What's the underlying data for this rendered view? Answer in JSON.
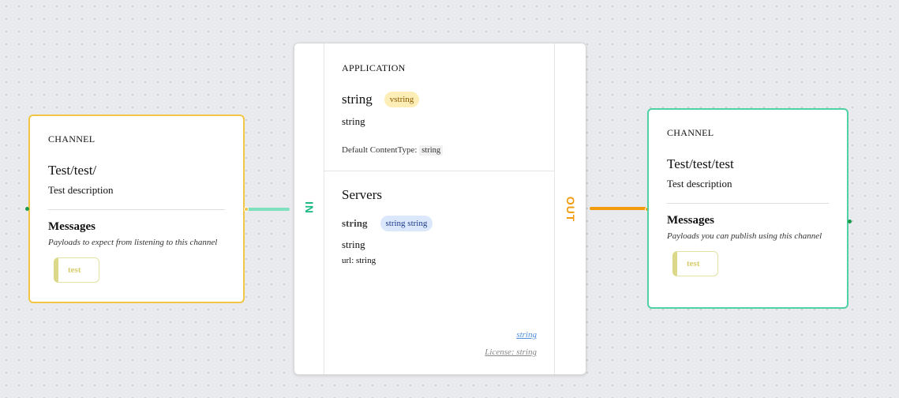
{
  "left_channel": {
    "type_label": "CHANNEL",
    "name": "Test/test/",
    "description": "Test description",
    "messages_title": "Messages",
    "messages_subtitle": "Payloads to expect from listening to this channel",
    "message_pill": "test"
  },
  "application": {
    "type_label": "APPLICATION",
    "title": "string",
    "version_badge": "vstring",
    "description": "string",
    "content_type_label": "Default ContentType:",
    "content_type_value": "string",
    "in_label": "IN",
    "out_label": "OUT",
    "servers": {
      "title": "Servers",
      "server_name": "string",
      "protocol_badge": "string string",
      "server_description": "string",
      "url_label": "url: string"
    },
    "terms_link": "string",
    "license_link": "License: string"
  },
  "right_channel": {
    "type_label": "CHANNEL",
    "name": "Test/test/test",
    "description": "Test description",
    "messages_title": "Messages",
    "messages_subtitle": "Payloads you can publish using this channel",
    "message_pill": "test"
  },
  "colors": {
    "subscribe_accent": "#f2c545",
    "publish_accent": "#4fd1a5",
    "in_color": "#19b783",
    "out_color": "#f29b0c"
  }
}
